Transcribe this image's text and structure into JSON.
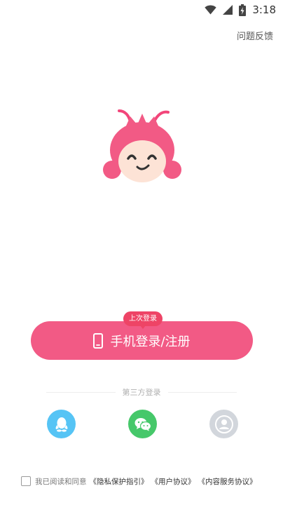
{
  "status_bar": {
    "time": "3:18",
    "icons": [
      "wifi-icon",
      "signal-icon",
      "battery-charging-icon"
    ]
  },
  "header": {
    "feedback_label": "问题反馈"
  },
  "login": {
    "last_login_badge": "上次登录",
    "phone_button_label": "手机登录/注册",
    "phone_button_icon": "phone-icon"
  },
  "third_party": {
    "divider_label": "第三方登录",
    "options": [
      {
        "icon": "qq-icon",
        "color": "#56c4f5"
      },
      {
        "icon": "wechat-icon",
        "color": "#46c86a"
      },
      {
        "icon": "user-icon",
        "color": "#d2d6dc"
      }
    ]
  },
  "agreement": {
    "prefix": "我已阅读和同意",
    "privacy_link": "《隐私保护指引》",
    "user_link": "《用户协议》",
    "content_link": "《内容服务协议》",
    "checked": false
  },
  "colors": {
    "accent": "#f25a85",
    "badge": "#ee4466"
  }
}
